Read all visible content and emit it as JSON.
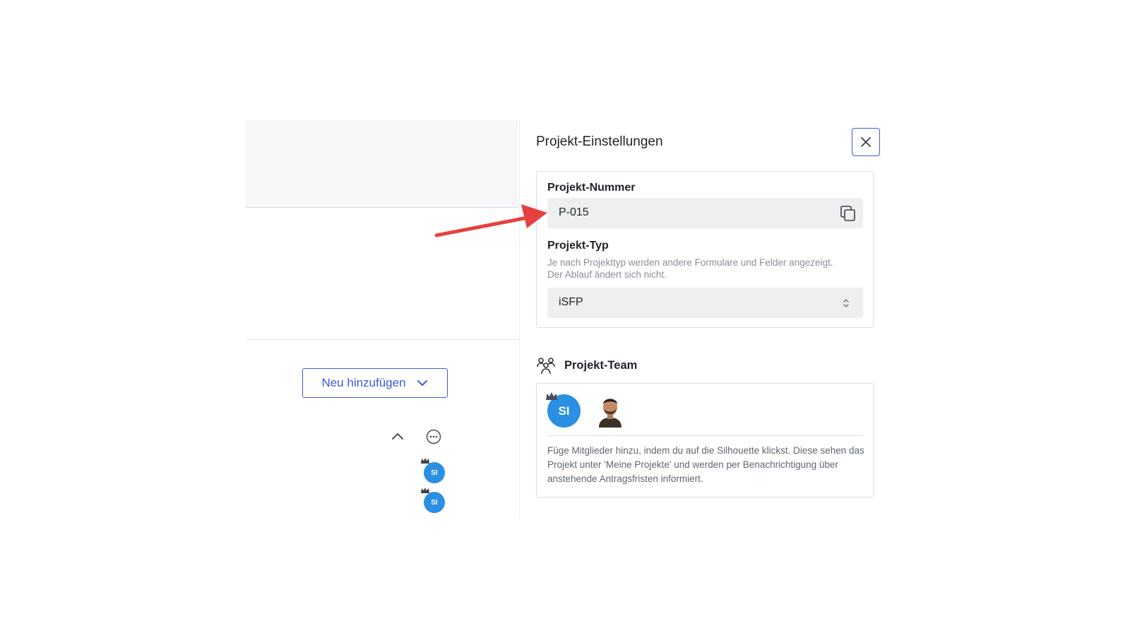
{
  "panel": {
    "title": "Projekt-Einstellungen",
    "close_icon": "close-icon"
  },
  "project_number": {
    "label": "Projekt-Nummer",
    "value": "P-015",
    "copy_icon": "copy-icon"
  },
  "project_type": {
    "label": "Projekt-Typ",
    "description": "Je nach Projekttyp werden andere Formulare und Felder angezeigt. Der Ablauf ändert sich nicht.",
    "selected": "iSFP"
  },
  "team": {
    "title": "Projekt-Team",
    "icon": "team-icon",
    "members": [
      {
        "initials": "SI",
        "owner": true
      },
      {
        "initials": "",
        "photo": true
      }
    ],
    "description": "Füge Mitglieder hinzu, indem du auf die Silhouette klickst. Diese sehen das Projekt unter 'Meine Projekte' und werden per Benachrichtigung über anstehende Antragsfristen informiert."
  },
  "background": {
    "add_button_label": "Neu hinzufügen",
    "row_avatars": [
      {
        "initials": "SI"
      },
      {
        "initials": "SI"
      }
    ]
  },
  "colors": {
    "accent": "#3b5bdb",
    "avatar": "#2b8fe4",
    "annotation_arrow": "#e84040"
  }
}
